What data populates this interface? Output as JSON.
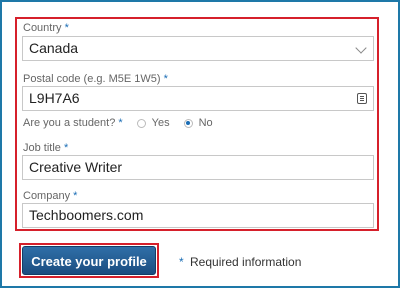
{
  "form": {
    "country": {
      "label": "Country",
      "required": "*",
      "value": "Canada"
    },
    "postal": {
      "label": "Postal code (e.g. M5E 1W5)",
      "required": "*",
      "value": "L9H7A6"
    },
    "student": {
      "question": "Are you a student?",
      "required": "*",
      "options": [
        "Yes",
        "No"
      ],
      "selected": "No"
    },
    "job": {
      "label": "Job title",
      "required": "*",
      "value": "Creative Writer"
    },
    "company": {
      "label": "Company",
      "required": "*",
      "value": "Techboomers.com"
    }
  },
  "actions": {
    "create_label": "Create your profile",
    "required_marker": "*",
    "required_text": "Required information"
  },
  "colors": {
    "accent": "#1a6db5",
    "highlight": "#d6202b",
    "frame": "#1e78a8"
  }
}
